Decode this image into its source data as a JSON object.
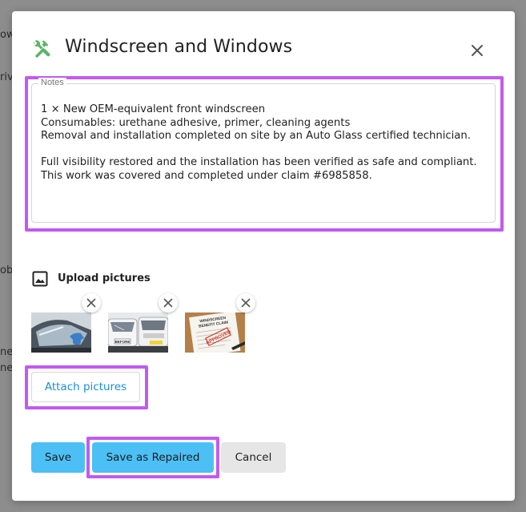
{
  "backdrop": {
    "fragments": [
      "ow",
      "riv",
      "obi",
      "ne",
      "ne c"
    ]
  },
  "dialog": {
    "title": "Windscreen and Windows",
    "title_icon": "hammer-wrench-icon",
    "close_icon": "close-icon",
    "accent_color": "#c25af0"
  },
  "notes": {
    "label": "Notes",
    "value": "1 × New OEM-equivalent front windscreen\nConsumables: urethane adhesive, primer, cleaning agents\nRemoval and installation completed on site by an Auto Glass certified technician.\n\nFull visibility restored and the installation has been verified as safe and compliant.\nThis work was covered and completed under claim #6985858."
  },
  "upload": {
    "label": "Upload pictures",
    "icon": "image-icon",
    "thumbnails": [
      {
        "icon": "windscreen-repair-photo",
        "caption": ""
      },
      {
        "icon": "before-cars-photo",
        "caption": "BEFORE"
      },
      {
        "icon": "benefit-claim-document-photo",
        "caption": "WINDSCREEN BENEFIT CLAIM",
        "stamp": "APPROVED"
      }
    ],
    "attach_label": "Attach pictures"
  },
  "actions": {
    "save_label": "Save",
    "repaired_label": "Save as Repaired",
    "cancel_label": "Cancel",
    "primary_color": "#4cc0f5",
    "link_color": "#1a8fd6"
  }
}
